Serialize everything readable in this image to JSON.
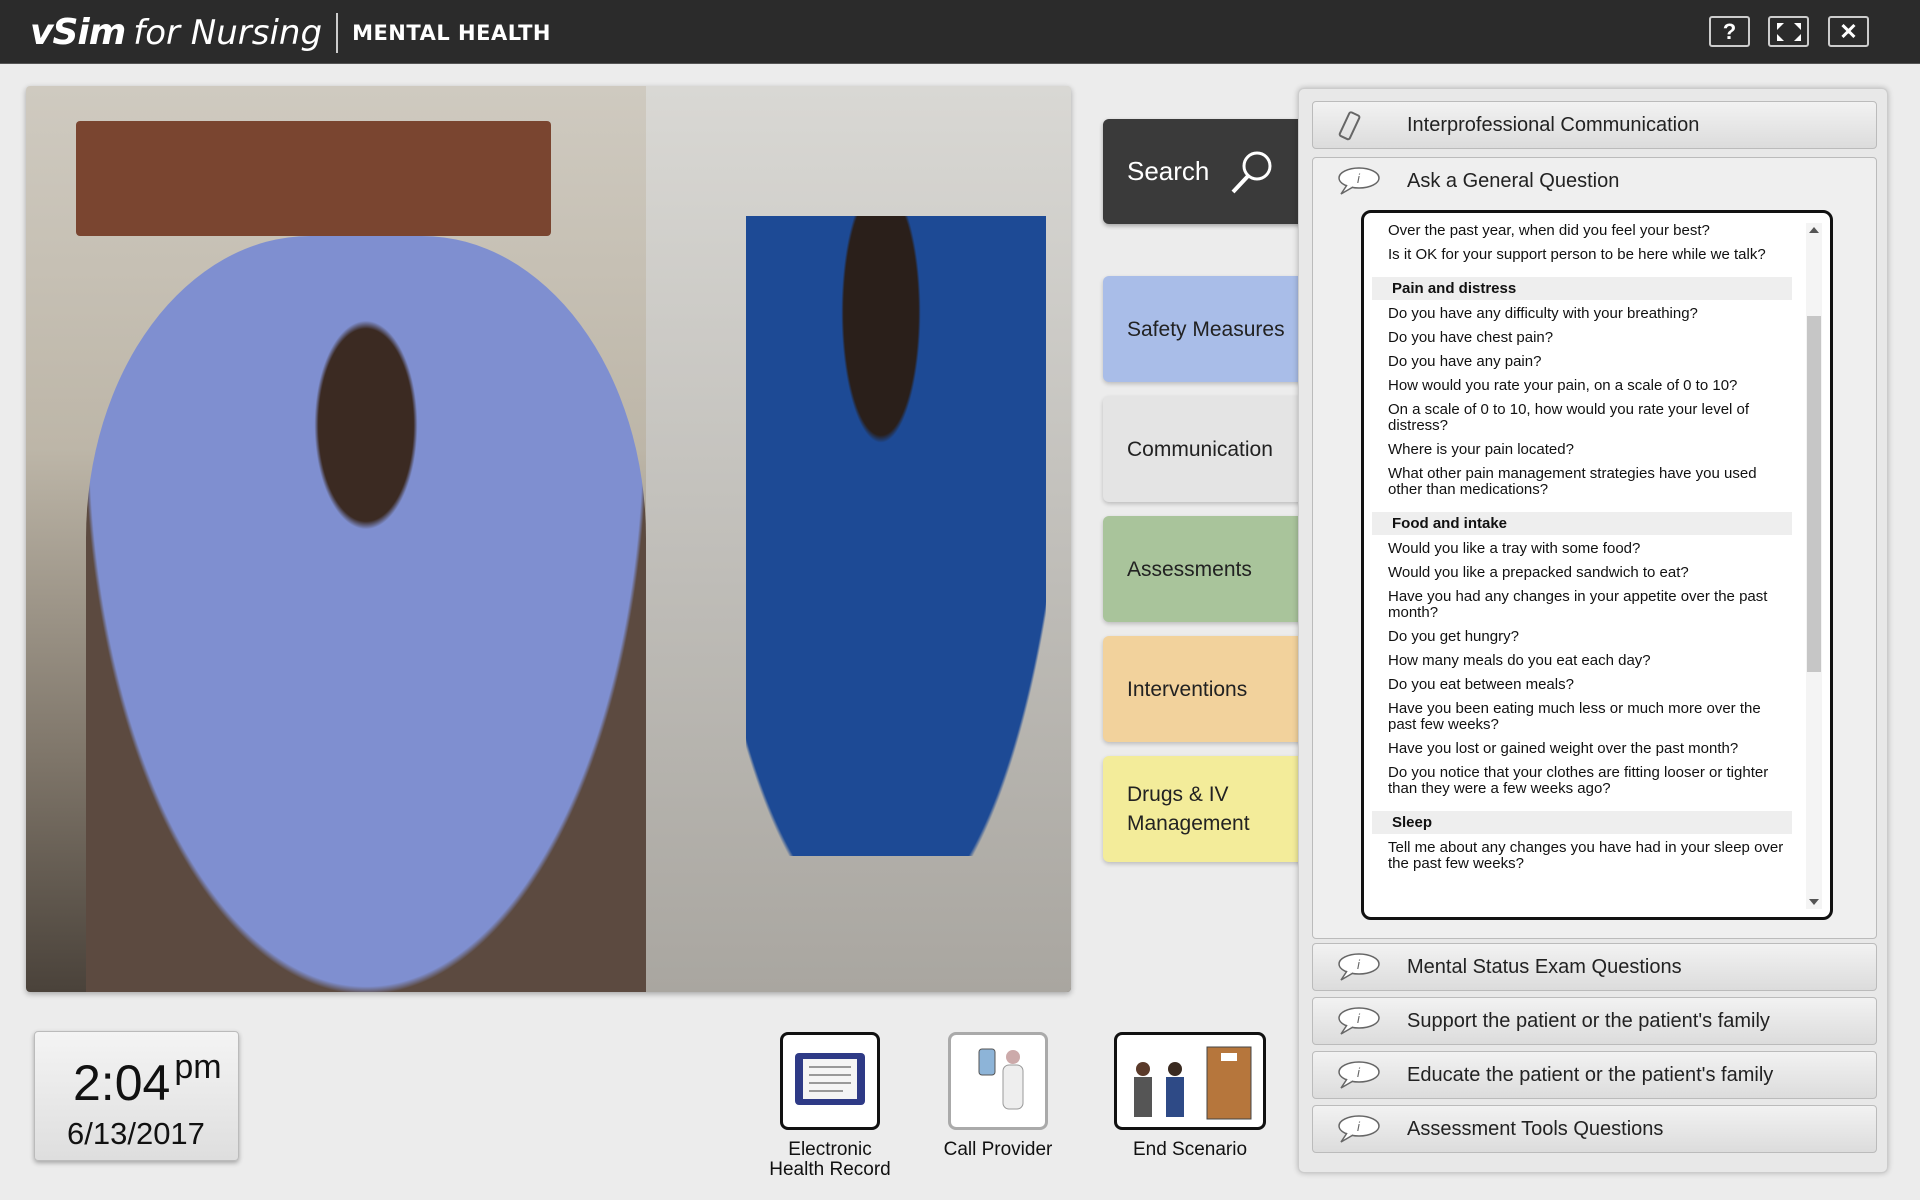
{
  "header": {
    "brand": "vSim",
    "brand_suffix": "for Nursing",
    "module": "MENTAL HEALTH",
    "help": "?",
    "close": "✕"
  },
  "search": {
    "label": "Search"
  },
  "categories": [
    {
      "label": "Safety Measures",
      "color": "#a9bde8"
    },
    {
      "label": "Communication",
      "color": "#e4e4e4"
    },
    {
      "label": "Assessments",
      "color": "#a9c49b"
    },
    {
      "label": "Interventions",
      "color": "#f2d29c"
    },
    {
      "label": "Drugs & IV Management",
      "color": "#f3ec9a"
    }
  ],
  "panel": {
    "top_section": "Interprofessional Communication",
    "open_section": "Ask a General Question",
    "questions_intro": [
      "Over the past year, when did you feel your best?",
      "Is it OK for your support person to be here while we talk?"
    ],
    "groups": [
      {
        "title": "Pain and distress",
        "items": [
          "Do you have any difficulty with your breathing?",
          "Do you have chest pain?",
          "Do you have any pain?",
          "How would you rate your pain, on a scale of 0 to 10?",
          "On a scale of 0 to 10, how would you rate your level of distress?",
          "Where is your pain located?",
          "What other pain management strategies have you used other than medications?"
        ]
      },
      {
        "title": "Food and intake",
        "items": [
          "Would you like a tray with some food?",
          "Would you like a prepacked sandwich to eat?",
          "Have you had any changes in your appetite over the past month?",
          "Do you get hungry?",
          "How many meals do you eat each day?",
          "Do you eat between meals?",
          "Have you been eating much less or much more over the past few weeks?",
          "Have you lost or gained weight over the past month?",
          "Do you notice that your clothes are fitting looser or tighter than they were a few weeks ago?"
        ]
      },
      {
        "title": "Sleep",
        "items": [
          "Tell me about any changes you have had in your sleep over the past few weeks?"
        ]
      }
    ],
    "bottom_sections": [
      "Mental Status Exam Questions",
      "Support the patient or the patient's family",
      "Educate the patient or the patient's family",
      "Assessment Tools Questions"
    ]
  },
  "clock": {
    "time": "2:04",
    "ampm": "pm",
    "date": "6/13/2017"
  },
  "tools": [
    {
      "label": "Electronic Health Record",
      "icon": "ehr-tablet-icon"
    },
    {
      "label": "Call Provider",
      "icon": "call-provider-icon"
    },
    {
      "label": "End Scenario",
      "icon": "exit-door-icon"
    }
  ]
}
